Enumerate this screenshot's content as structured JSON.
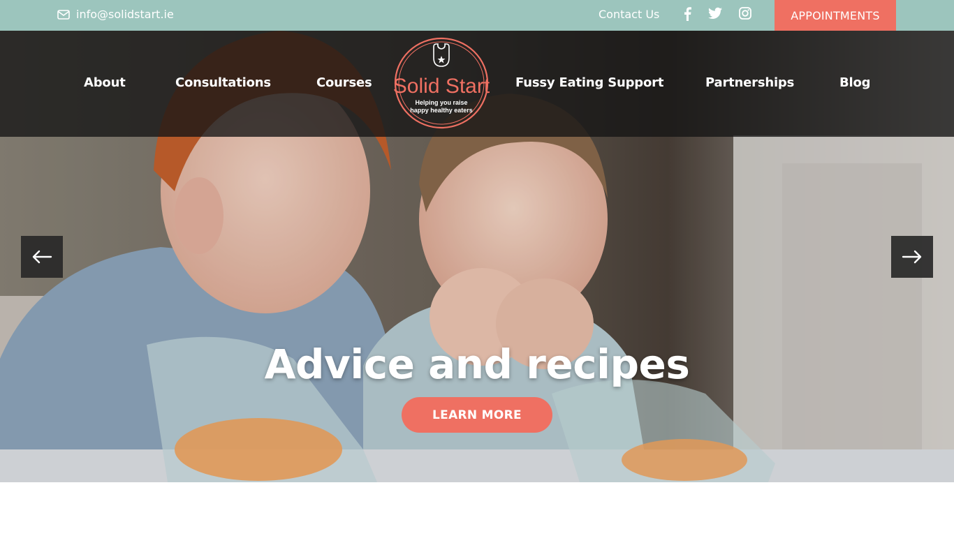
{
  "topbar": {
    "email": "info@solidstart.ie",
    "contact_label": "Contact Us",
    "appointments_label": "APPOINTMENTS",
    "social": [
      "facebook-icon",
      "twitter-icon",
      "instagram-icon"
    ]
  },
  "nav": {
    "items": [
      {
        "label": "About"
      },
      {
        "label": "Consultations"
      },
      {
        "label": "Courses"
      },
      {
        "label": "Fussy Eating Support"
      },
      {
        "label": "Partnerships"
      },
      {
        "label": "Blog"
      }
    ]
  },
  "logo": {
    "title": "Solid Start",
    "tagline_line1": "Helping you raise",
    "tagline_line2": "happy healthy eaters"
  },
  "hero": {
    "headline": "Advice and recipes",
    "cta_label": "LEARN MORE"
  },
  "colors": {
    "topbar": "#9cc5bd",
    "accent": "#ef7062",
    "nav_bg": "#141414"
  }
}
